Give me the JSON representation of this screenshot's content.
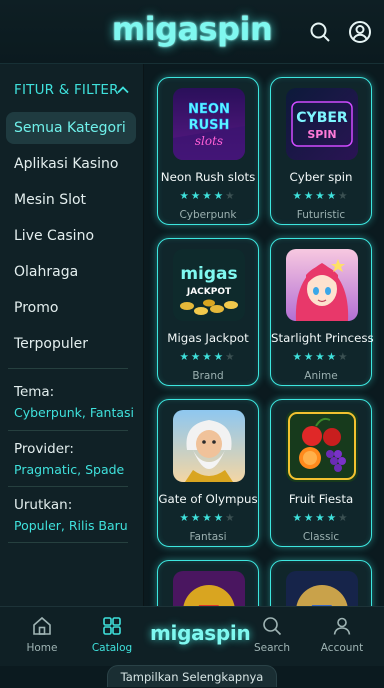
{
  "header": {
    "logo": "migaspin"
  },
  "sidebar": {
    "title": "FITUR & FILTER",
    "categories": [
      {
        "label": "Semua Kategori"
      },
      {
        "label": "Aplikasi Kasino"
      },
      {
        "label": "Mesin Slot"
      },
      {
        "label": "Live Casino"
      },
      {
        "label": "Olahraga"
      },
      {
        "label": "Promo"
      },
      {
        "label": "Terpopuler"
      }
    ],
    "filters": {
      "theme_label": "Tema:",
      "theme_value": "Cyberpunk, Fantasi",
      "provider_label": "Provider:",
      "provider_value": "Pragmatic, Spade",
      "sort_label": "Urutkan:",
      "sort_value": "Populer, Rilis Baru"
    }
  },
  "games": [
    {
      "title": "Neon Rush slots",
      "tag": "Cyberpunk",
      "rating": 4,
      "thumb_text": [
        "NEON",
        "RUSH",
        "slots"
      ]
    },
    {
      "title": "Cyber spin",
      "tag": "Futuristic",
      "rating": 4,
      "thumb_text": [
        "CYBER",
        "SPIN"
      ]
    },
    {
      "title": "Migas Jackpot",
      "tag": "Brand",
      "rating": 4,
      "thumb_text": [
        "migas",
        "JACKPOT"
      ]
    },
    {
      "title": "Starlight Princess",
      "tag": "Anime",
      "rating": 4
    },
    {
      "title": "Gate of Olympus",
      "tag": "Fantasi",
      "rating": 4
    },
    {
      "title": "Fruit Fiesta",
      "tag": "Classic",
      "rating": 4
    }
  ],
  "bottom_nav": {
    "home": "Home",
    "catalog": "Catalog",
    "logo": "migaspin",
    "search": "Search",
    "account": "Account"
  },
  "more_button": "Tampilkan Selengkapnya",
  "colors": {
    "accent": "#3fe1dc",
    "background": "#0b1a1f",
    "panel": "#102126"
  },
  "icons": [
    "search-icon",
    "account-icon",
    "chevron-up-icon",
    "home-icon",
    "catalog-icon",
    "search-icon",
    "account-icon"
  ]
}
